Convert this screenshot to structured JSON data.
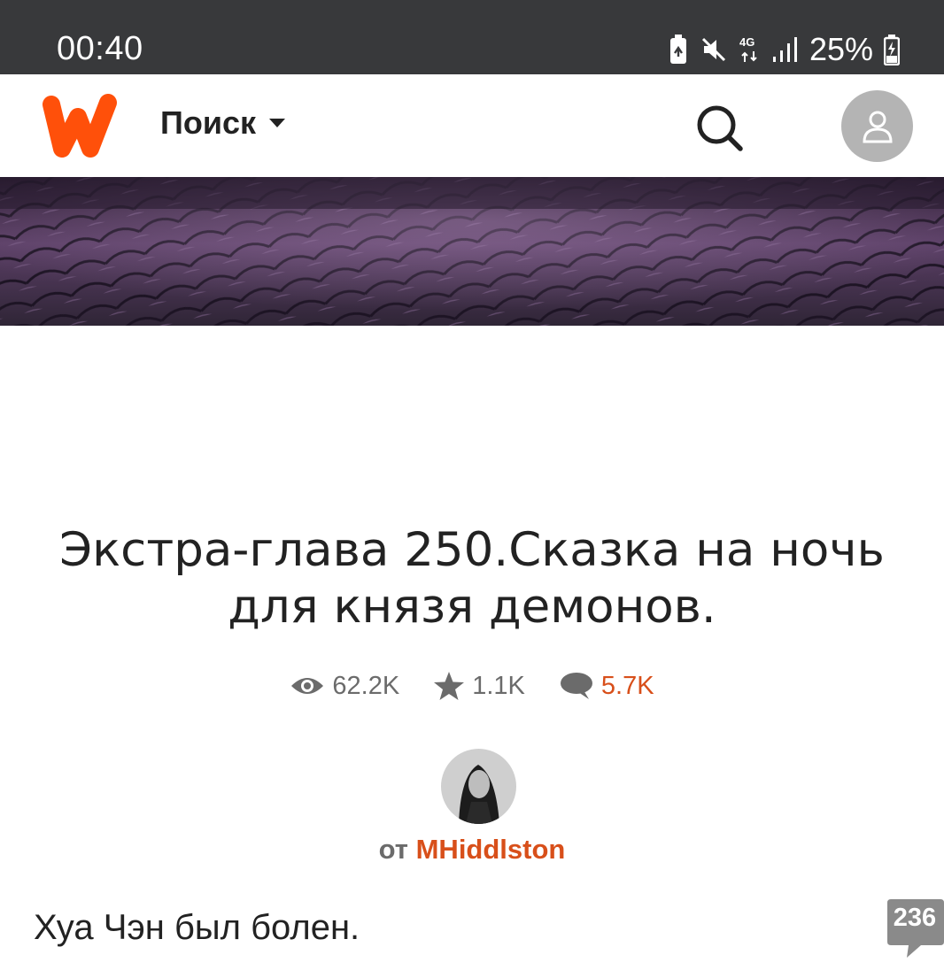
{
  "status_bar": {
    "time": "00:40",
    "network": "4G",
    "battery": "25%",
    "icons": [
      "battery-saver-icon",
      "mute-icon",
      "network-4g-icon",
      "signal-icon",
      "battery-charging-icon"
    ]
  },
  "header": {
    "logo_icon": "wattpad-logo-icon",
    "search_label": "Поиск",
    "search_icon": "search-icon",
    "account_icon": "user-icon",
    "accent": "#ff500a"
  },
  "story": {
    "title": "Экстра-глава 250.Сказка на ночь для князя демонов.",
    "stats": {
      "reads": "62.2K",
      "votes": "1.1K",
      "comments": "5.7K"
    },
    "author_prefix": "от",
    "author": "MHiddlston",
    "first_paragraph": "Хуа Чэн был болен.",
    "paragraph_comment_count": "236",
    "accent": "#d84f1a"
  }
}
